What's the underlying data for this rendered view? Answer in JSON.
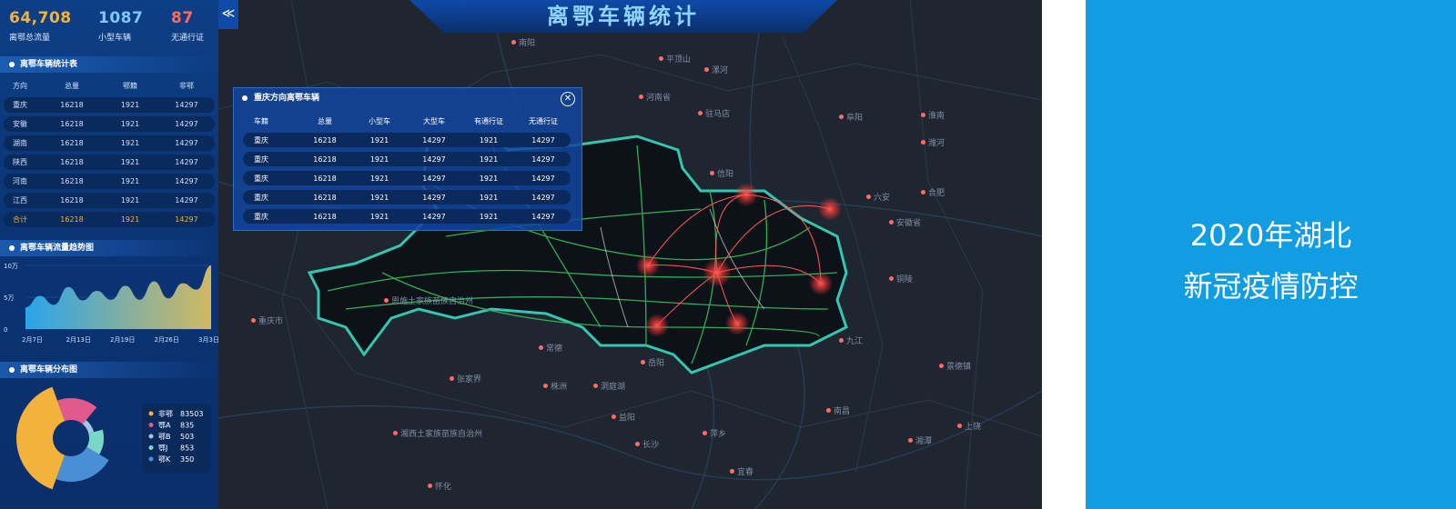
{
  "stats": [
    {
      "value": "64,708",
      "label": "离鄂总流量",
      "color": "#f3b23c"
    },
    {
      "value": "1087",
      "label": "小型车辆",
      "color": "#7ec8ff"
    },
    {
      "value": "87",
      "label": "无通行证",
      "color": "#ff6b5b"
    }
  ],
  "stat_table": {
    "title": "离鄂车辆统计表",
    "headers": [
      "方向",
      "总量",
      "鄂籍",
      "非鄂"
    ],
    "rows": [
      [
        "重庆",
        "16218",
        "1921",
        "14297"
      ],
      [
        "安徽",
        "16218",
        "1921",
        "14297"
      ],
      [
        "湖南",
        "16218",
        "1921",
        "14297"
      ],
      [
        "陕西",
        "16218",
        "1921",
        "14297"
      ],
      [
        "河南",
        "16218",
        "1921",
        "14297"
      ],
      [
        "江西",
        "16218",
        "1921",
        "14297"
      ],
      [
        "合计",
        "16218",
        "1921",
        "14297"
      ]
    ]
  },
  "trend": {
    "title": "离鄂车辆流量趋势图"
  },
  "chart_data": {
    "type": "area",
    "x": [
      "2月7日",
      "2月13日",
      "2月19日",
      "2月26日",
      "3月3日"
    ],
    "y_ticks": [
      "10万",
      "5万",
      "0"
    ],
    "values": [
      3.4,
      5.2,
      3.8,
      6.6,
      4.5,
      6.0,
      4.6,
      6.8,
      4.6,
      7.5,
      4.8,
      7.2,
      6.2,
      10.0
    ],
    "ylim": [
      0,
      10
    ],
    "colors": [
      "#2fb8ff",
      "#f3d060"
    ]
  },
  "distribution": {
    "title": "离鄂车辆分布图",
    "legend": [
      {
        "name": "非鄂",
        "value": "83503",
        "color": "#f3b23c"
      },
      {
        "name": "鄂A",
        "value": "835",
        "color": "#e05a8c"
      },
      {
        "name": "鄂B",
        "value": "503",
        "color": "#9fc8e8"
      },
      {
        "name": "鄂J",
        "value": "853",
        "color": "#7ad7c7"
      },
      {
        "name": "鄂K",
        "value": "350",
        "color": "#4a8fd6"
      }
    ]
  },
  "map": {
    "title": "离鄂车辆统计",
    "collapse_glyph": "≪",
    "cities": [
      "合肥",
      "安徽省",
      "河南省",
      "南昌",
      "长沙",
      "张家界",
      "重庆市",
      "驻马店",
      "阜阳",
      "六安",
      "铜陵",
      "九江",
      "洞庭湖",
      "宜春",
      "恩施土家族苗族自治州",
      "湘西土家族苗族自治州",
      "潍河",
      "漯河",
      "平顶山",
      "信阳",
      "淮南",
      "怀化",
      "株洲",
      "萍乡",
      "景德镇",
      "上饶",
      "湘潭",
      "岳阳",
      "常德",
      "益阳",
      "南阳"
    ]
  },
  "popup": {
    "title": "重庆方向离鄂车辆",
    "close_glyph": "✕",
    "headers": [
      "车籍",
      "总量",
      "小型车",
      "大型车",
      "有通行证",
      "无通行证"
    ],
    "rows": [
      [
        "重庆",
        "16218",
        "1921",
        "14297",
        "1921",
        "14297"
      ],
      [
        "重庆",
        "16218",
        "1921",
        "14297",
        "1921",
        "14297"
      ],
      [
        "重庆",
        "16218",
        "1921",
        "14297",
        "1921",
        "14297"
      ],
      [
        "重庆",
        "16218",
        "1921",
        "14297",
        "1921",
        "14297"
      ],
      [
        "重庆",
        "16218",
        "1921",
        "14297",
        "1921",
        "14297"
      ]
    ]
  },
  "caption": {
    "line1": "2020年湖北",
    "line2": "新冠疫情防控"
  }
}
